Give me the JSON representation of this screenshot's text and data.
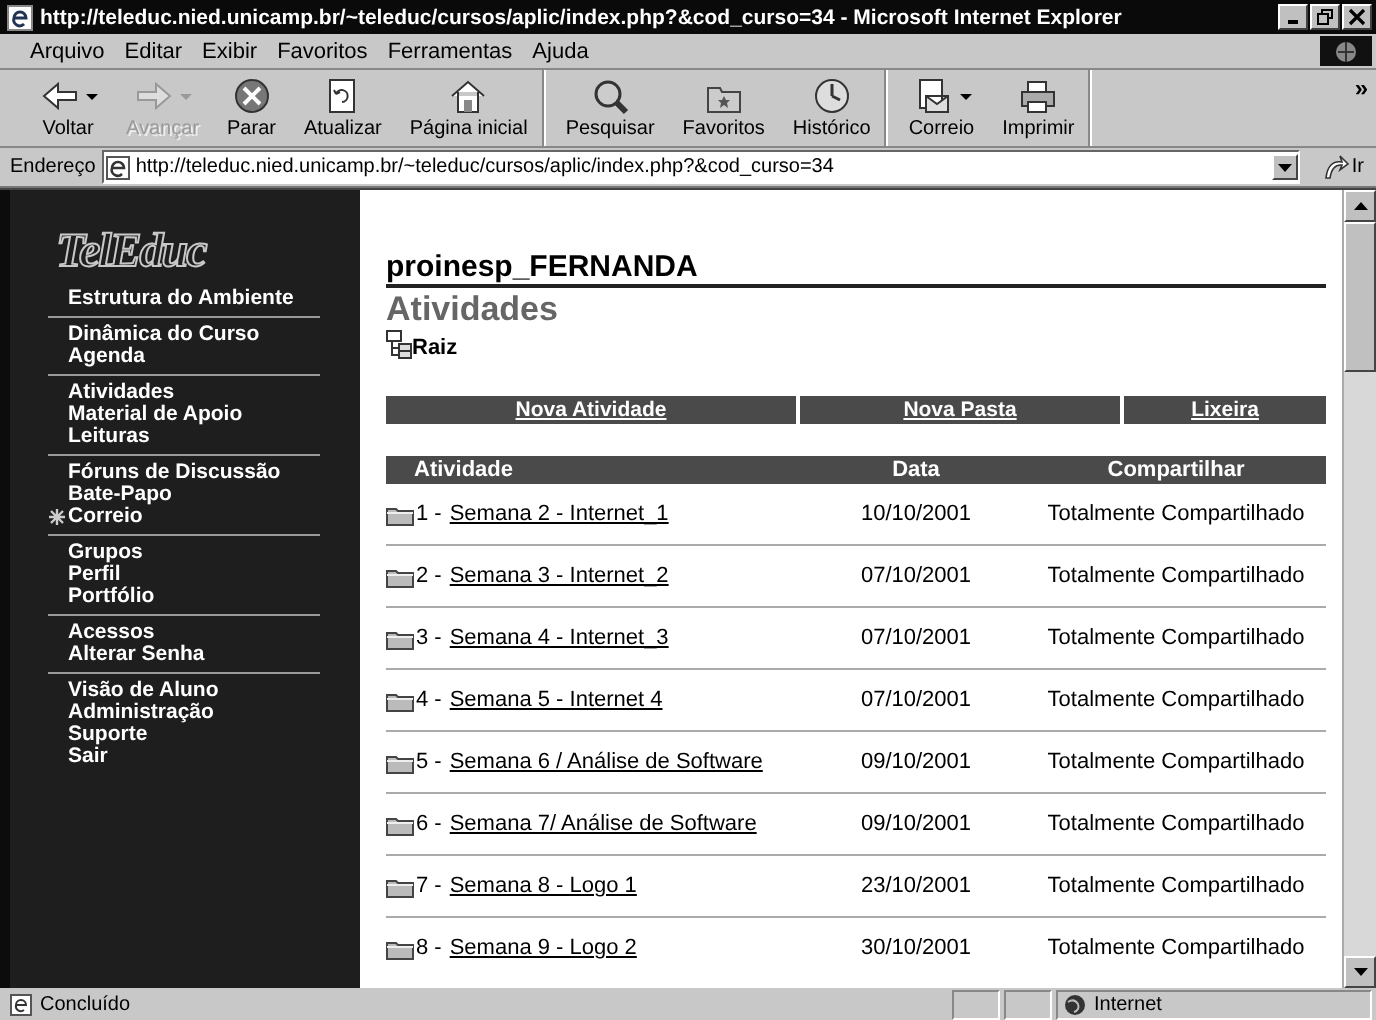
{
  "window": {
    "title": "http://teleduc.nied.unicamp.br/~teleduc/cursos/aplic/index.php?&cod_curso=34 - Microsoft Internet Explorer"
  },
  "menu": [
    "Arquivo",
    "Editar",
    "Exibir",
    "Favoritos",
    "Ferramentas",
    "Ajuda"
  ],
  "toolbar": {
    "groups": [
      [
        {
          "label": "Voltar",
          "disabled": false,
          "has_menu": true
        },
        {
          "label": "Avançar",
          "disabled": true,
          "has_menu": true
        },
        {
          "label": "Parar",
          "disabled": false,
          "has_menu": false
        },
        {
          "label": "Atualizar",
          "disabled": false,
          "has_menu": false
        },
        {
          "label": "Página inicial",
          "disabled": false,
          "has_menu": false
        }
      ],
      [
        {
          "label": "Pesquisar",
          "disabled": false,
          "has_menu": false
        },
        {
          "label": "Favoritos",
          "disabled": false,
          "has_menu": false
        },
        {
          "label": "Histórico",
          "disabled": false,
          "has_menu": false
        }
      ],
      [
        {
          "label": "Correio",
          "disabled": false,
          "has_menu": true
        },
        {
          "label": "Imprimir",
          "disabled": false,
          "has_menu": false
        }
      ]
    ],
    "more": "»"
  },
  "address": {
    "label": "Endereço",
    "value": "http://teleduc.nied.unicamp.br/~teleduc/cursos/aplic/index.php?&cod_curso=34",
    "go": "Ir"
  },
  "sidebar": {
    "logo": "TelEduc",
    "groups": [
      [
        {
          "label": "Estrutura do Ambiente",
          "marked": false
        }
      ],
      [
        {
          "label": "Dinâmica do Curso",
          "marked": false
        },
        {
          "label": "Agenda",
          "marked": false
        }
      ],
      [
        {
          "label": "Atividades",
          "marked": false
        },
        {
          "label": "Material de Apoio",
          "marked": false
        },
        {
          "label": "Leituras",
          "marked": false
        }
      ],
      [
        {
          "label": "Fóruns de Discussão",
          "marked": false
        },
        {
          "label": "Bate-Papo",
          "marked": false
        },
        {
          "label": "Correio",
          "marked": true
        }
      ],
      [
        {
          "label": "Grupos",
          "marked": false
        },
        {
          "label": "Perfil",
          "marked": false
        },
        {
          "label": "Portfólio",
          "marked": false
        }
      ],
      [
        {
          "label": "Acessos",
          "marked": false
        },
        {
          "label": "Alterar Senha",
          "marked": false
        }
      ],
      [
        {
          "label": "Visão de Aluno",
          "marked": false
        },
        {
          "label": "Administração",
          "marked": false
        },
        {
          "label": "Suporte",
          "marked": false
        },
        {
          "label": "Sair",
          "marked": false
        }
      ]
    ]
  },
  "content": {
    "course": "proinesp_FERNANDA",
    "heading": "Atividades",
    "folder": "Raiz",
    "actions": [
      "Nova Atividade",
      "Nova Pasta",
      "Lixeira"
    ],
    "table": {
      "columns": [
        "Atividade",
        "Data",
        "Compartilhar"
      ],
      "rows": [
        {
          "number": "1 -",
          "title": "Semana 2 - Internet_1",
          "date": "10/10/2001",
          "sharing": "Totalmente Compartilhado"
        },
        {
          "number": "2 -",
          "title": "Semana 3 - Internet_2",
          "date": "07/10/2001",
          "sharing": "Totalmente Compartilhado"
        },
        {
          "number": "3 -",
          "title": "Semana 4 - Internet_3",
          "date": "07/10/2001",
          "sharing": "Totalmente Compartilhado"
        },
        {
          "number": "4 -",
          "title": "Semana 5 - Internet 4",
          "date": "07/10/2001",
          "sharing": "Totalmente Compartilhado"
        },
        {
          "number": "5 -",
          "title": "Semana 6 / Análise de Software",
          "date": "09/10/2001",
          "sharing": "Totalmente Compartilhado"
        },
        {
          "number": "6 -",
          "title": "Semana 7/ Análise de Software",
          "date": "09/10/2001",
          "sharing": "Totalmente Compartilhado"
        },
        {
          "number": "7 -",
          "title": "Semana 8 - Logo 1",
          "date": "23/10/2001",
          "sharing": "Totalmente Compartilhado"
        },
        {
          "number": "8 -",
          "title": "Semana 9 - Logo 2",
          "date": "30/10/2001",
          "sharing": "Totalmente Compartilhado"
        }
      ]
    }
  },
  "status_bar": {
    "text": "Concluído",
    "zone": "Internet"
  }
}
